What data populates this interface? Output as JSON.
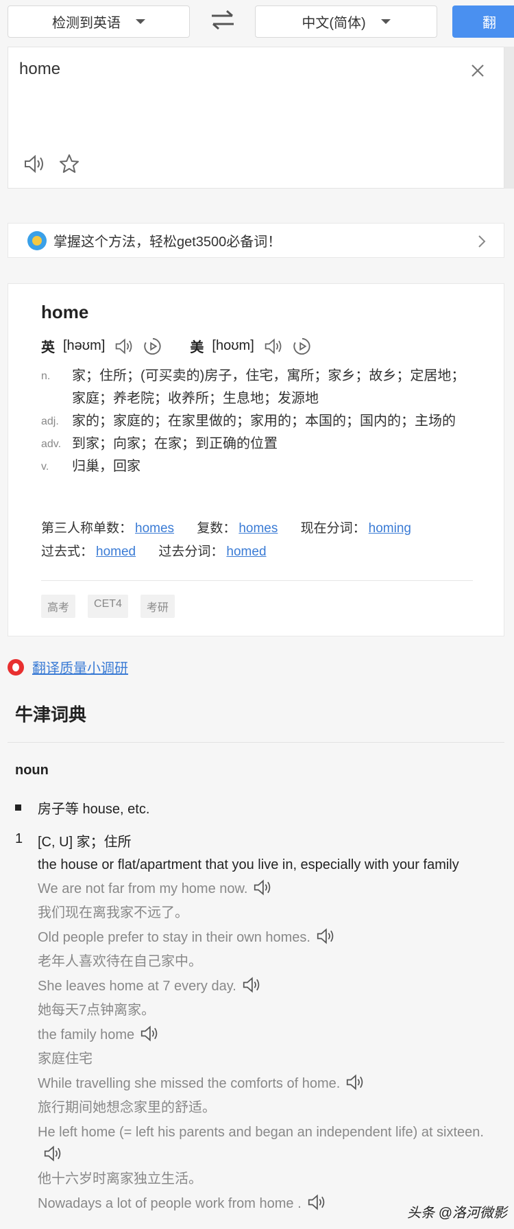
{
  "topbar": {
    "source_lang": "检测到英语",
    "target_lang": "中文(简体)",
    "translate_btn": "翻"
  },
  "input": {
    "text": "home"
  },
  "banner": {
    "text": "掌握这个方法，轻松get3500必备词！"
  },
  "entry": {
    "word": "home",
    "uk_label": "英",
    "uk_ipa": "[həʊm]",
    "us_label": "美",
    "us_ipa": "[hoʊm]",
    "definitions": [
      {
        "pos": "n.",
        "meaning": "家；住所；(可买卖的)房子，住宅，寓所；家乡；故乡；定居地；家庭；养老院；收养所；生息地；发源地"
      },
      {
        "pos": "adj.",
        "meaning": "家的；家庭的；在家里做的；家用的；本国的；国内的；主场的"
      },
      {
        "pos": "adv.",
        "meaning": "到家；向家；在家；到正确的位置"
      },
      {
        "pos": "v.",
        "meaning": "归巢，回家"
      }
    ],
    "forms": {
      "third_label": "第三人称单数：",
      "third": "homes",
      "plural_label": "复数：",
      "plural": "homes",
      "present_label": "现在分词：",
      "present": "homing",
      "past_label": "过去式：",
      "past": "homed",
      "pp_label": "过去分词：",
      "pp": "homed"
    },
    "tags": [
      "高考",
      "CET4",
      "考研"
    ]
  },
  "survey": {
    "link": "翻译质量小调研"
  },
  "oxford": {
    "title": "牛津词典",
    "pos": "noun",
    "bullet": "房子等 house, etc.",
    "sense_num": "1",
    "sense_head": "[C, U] 家；住所",
    "sense_def": "the house or flat/apartment that you live in, especially with your family",
    "examples": [
      {
        "en": "We are not far from my home now.",
        "zh": "我们现在离我家不远了。"
      },
      {
        "en": "Old people prefer to stay in their own homes.",
        "zh": "老年人喜欢待在自己家中。"
      },
      {
        "en": "She leaves home at 7 every day.",
        "zh": "她每天7点钟离家。"
      },
      {
        "en": "the family home",
        "zh": "家庭住宅"
      },
      {
        "en": "While travelling she missed the comforts of home.",
        "zh": "旅行期间她想念家里的舒适。"
      },
      {
        "en": "He left home (= left his parents and began an independent life) at sixteen.",
        "zh": "他十六岁时离家独立生活。"
      },
      {
        "en": "Nowadays a lot of people work from home .",
        "zh": ""
      }
    ]
  },
  "watermark": "头条 @洛河微影",
  "colors": {
    "accent": "#4a90f0",
    "link": "#3a7bd5",
    "muted": "#888888"
  }
}
